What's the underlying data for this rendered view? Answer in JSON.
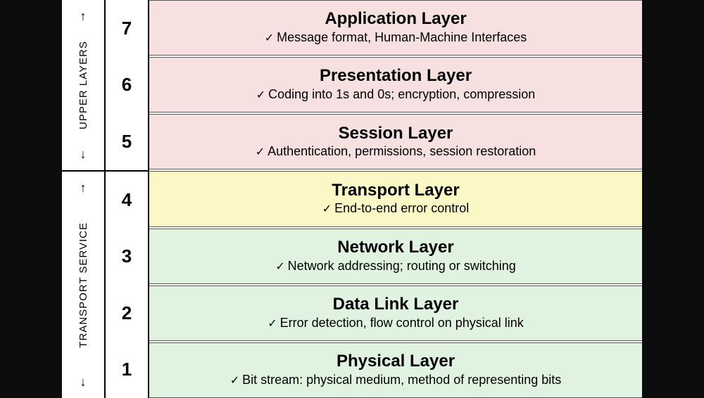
{
  "groups": {
    "upper": "UPPER LAYERS",
    "lower": "TRANSPORT SERVICE"
  },
  "layers": [
    {
      "num": "7",
      "title": "Application Layer",
      "desc": "Message format, Human-Machine Interfaces",
      "color": "pink",
      "group": "upper"
    },
    {
      "num": "6",
      "title": "Presentation Layer",
      "desc": "Coding into 1s and 0s; encryption, compression",
      "color": "pink",
      "group": "upper"
    },
    {
      "num": "5",
      "title": "Session Layer",
      "desc": "Authentication, permissions, session restoration",
      "color": "pink",
      "group": "upper"
    },
    {
      "num": "4",
      "title": "Transport Layer",
      "desc": "End-to-end error control",
      "color": "yellow",
      "group": "lower"
    },
    {
      "num": "3",
      "title": "Network Layer",
      "desc": "Network addressing; routing or switching",
      "color": "green",
      "group": "lower"
    },
    {
      "num": "2",
      "title": "Data Link Layer",
      "desc": "Error detection, flow control on physical link",
      "color": "green",
      "group": "lower"
    },
    {
      "num": "1",
      "title": "Physical Layer",
      "desc": "Bit stream: physical medium, method of representing bits",
      "color": "green",
      "group": "lower"
    }
  ]
}
